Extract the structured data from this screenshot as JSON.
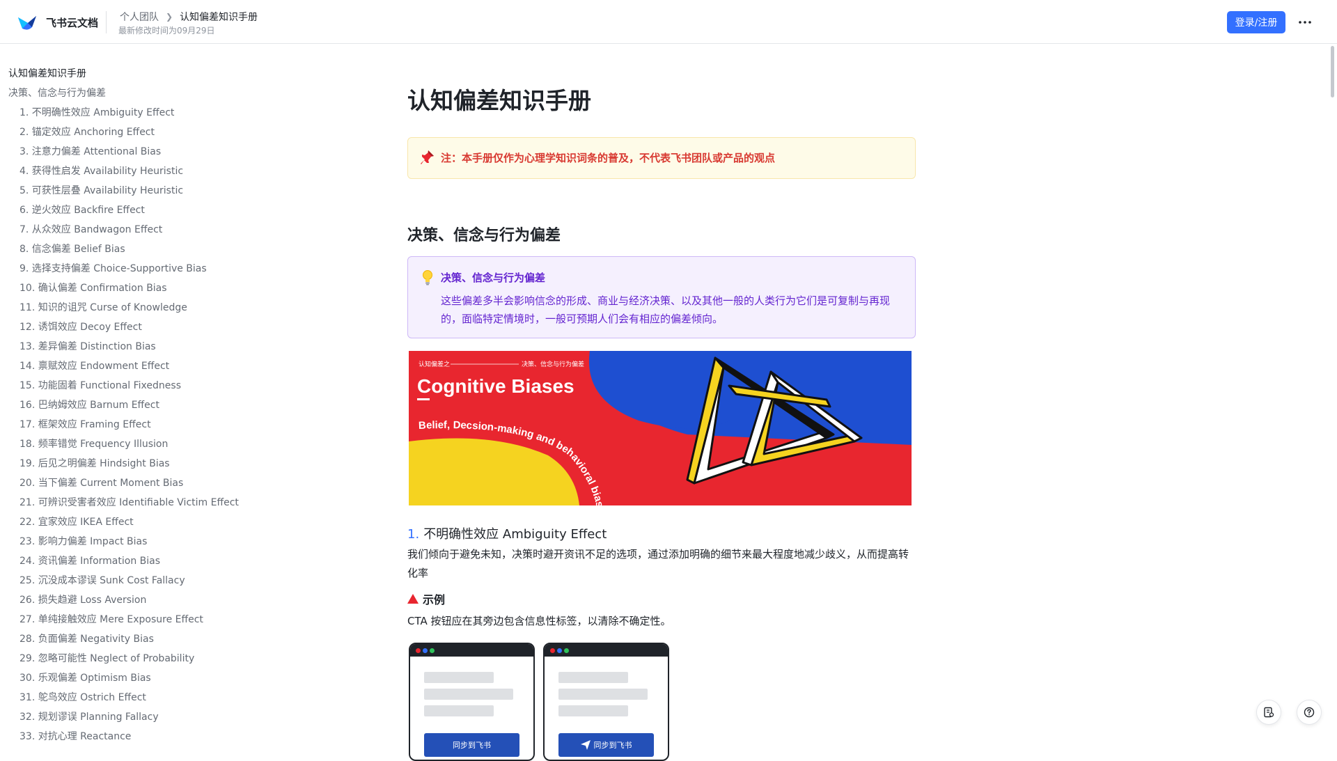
{
  "header": {
    "brand": "飞书云文档",
    "breadcrumb_team": "个人团队",
    "breadcrumb_doc": "认知偏差知识手册",
    "modified": "最新修改时间为09月29日",
    "login_label": "登录/注册"
  },
  "toc": {
    "items": [
      {
        "label": "认知偏差知识手册",
        "level": 1
      },
      {
        "label": "决策、信念与行为偏差",
        "level": 1
      },
      {
        "label": "1. 不明确性效应 Ambiguity Effect",
        "level": 2
      },
      {
        "label": "2. 锚定效应 Anchoring Effect",
        "level": 2
      },
      {
        "label": "3. 注意力偏差 Attentional Bias",
        "level": 2
      },
      {
        "label": "4. 获得性启发 Availability Heuristic",
        "level": 2
      },
      {
        "label": "5. 可获性层叠 Availability Heuristic",
        "level": 2
      },
      {
        "label": "6. 逆火效应 Backfire Effect",
        "level": 2
      },
      {
        "label": "7. 从众效应 Bandwagon Effect",
        "level": 2
      },
      {
        "label": "8. 信念偏差 Belief Bias",
        "level": 2
      },
      {
        "label": "9. 选择支持偏差 Choice-Supportive Bias",
        "level": 2
      },
      {
        "label": "10. 确认偏差 Confirmation Bias",
        "level": 2
      },
      {
        "label": "11. 知识的诅咒 Curse of Knowledge",
        "level": 2
      },
      {
        "label": "12. 诱饵效应 Decoy Effect",
        "level": 2
      },
      {
        "label": "13. 差异偏差 Distinction Bias",
        "level": 2
      },
      {
        "label": "14. 禀赋效应 Endowment Effect",
        "level": 2
      },
      {
        "label": "15. 功能固着 Functional Fixedness",
        "level": 2
      },
      {
        "label": "16. 巴纳姆效应 Barnum Effect",
        "level": 2
      },
      {
        "label": "17. 框架效应 Framing Effect",
        "level": 2
      },
      {
        "label": "18. 频率错觉 Frequency Illusion",
        "level": 2
      },
      {
        "label": "19. 后见之明偏差 Hindsight Bias",
        "level": 2
      },
      {
        "label": "20. 当下偏差 Current Moment Bias",
        "level": 2
      },
      {
        "label": "21. 可辨识受害者效应 Identifiable Victim Effect",
        "level": 2
      },
      {
        "label": "22. 宜家效应 IKEA Effect",
        "level": 2
      },
      {
        "label": "23. 影响力偏差 Impact Bias",
        "level": 2
      },
      {
        "label": "24. 资讯偏差 Information Bias",
        "level": 2
      },
      {
        "label": "25. 沉没成本谬误 Sunk Cost Fallacy",
        "level": 2
      },
      {
        "label": "26. 损失趋避 Loss Aversion",
        "level": 2
      },
      {
        "label": "27. 单纯接触效应 Mere Exposure Effect",
        "level": 2
      },
      {
        "label": "28. 负面偏差 Negativity Bias",
        "level": 2
      },
      {
        "label": "29. 忽略可能性 Neglect of Probability",
        "level": 2
      },
      {
        "label": "30. 乐观偏差 Optimism Bias",
        "level": 2
      },
      {
        "label": "31. 鸵鸟效应 Ostrich Effect",
        "level": 2
      },
      {
        "label": "32. 规划谬误 Planning Fallacy",
        "level": 2
      },
      {
        "label": "33. 对抗心理 Reactance",
        "level": 2
      }
    ]
  },
  "doc": {
    "title": "认知偏差知识手册",
    "note": "注：本手册仅作为心理学知识词条的普及，不代表飞书团队或产品的观点",
    "section_title": "决策、信念与行为偏差",
    "callout_title": "决策、信念与行为偏差",
    "callout_body": "这些偏差多半会影响信念的形成、商业与经济决策、以及其他一般的人类行为它们是可复制与再现的，面临特定情境时，一般可预期人们会有相应的偏差倾向。",
    "banner": {
      "tag_left": "认知偏差之",
      "tag_right": "决策、信念与行为偏差",
      "title": "Cognitive Biases",
      "subtitle": "Belief, Decsion-making and behavioral biases"
    },
    "item1_num": "1.",
    "item1_title": "不明确性效应 Ambiguity Effect",
    "item1_desc": "我们倾向于避免未知，决策时避开资讯不足的选项，通过添加明确的细节来最大程度地减少歧义，从而提高转化率",
    "example_label": "示例",
    "example_text": "CTA 按钮应在其旁边包含信息性标签，以清除不确定性。",
    "mock_btn_1": "同步到飞书",
    "mock_btn_2": "同步到飞书"
  },
  "colors": {
    "accent": "#3370ff",
    "note_text": "#d83931",
    "callout_text": "#6425d0",
    "banner_red": "#e8262f",
    "banner_blue": "#1e4fd1",
    "banner_yellow": "#f5d320"
  }
}
